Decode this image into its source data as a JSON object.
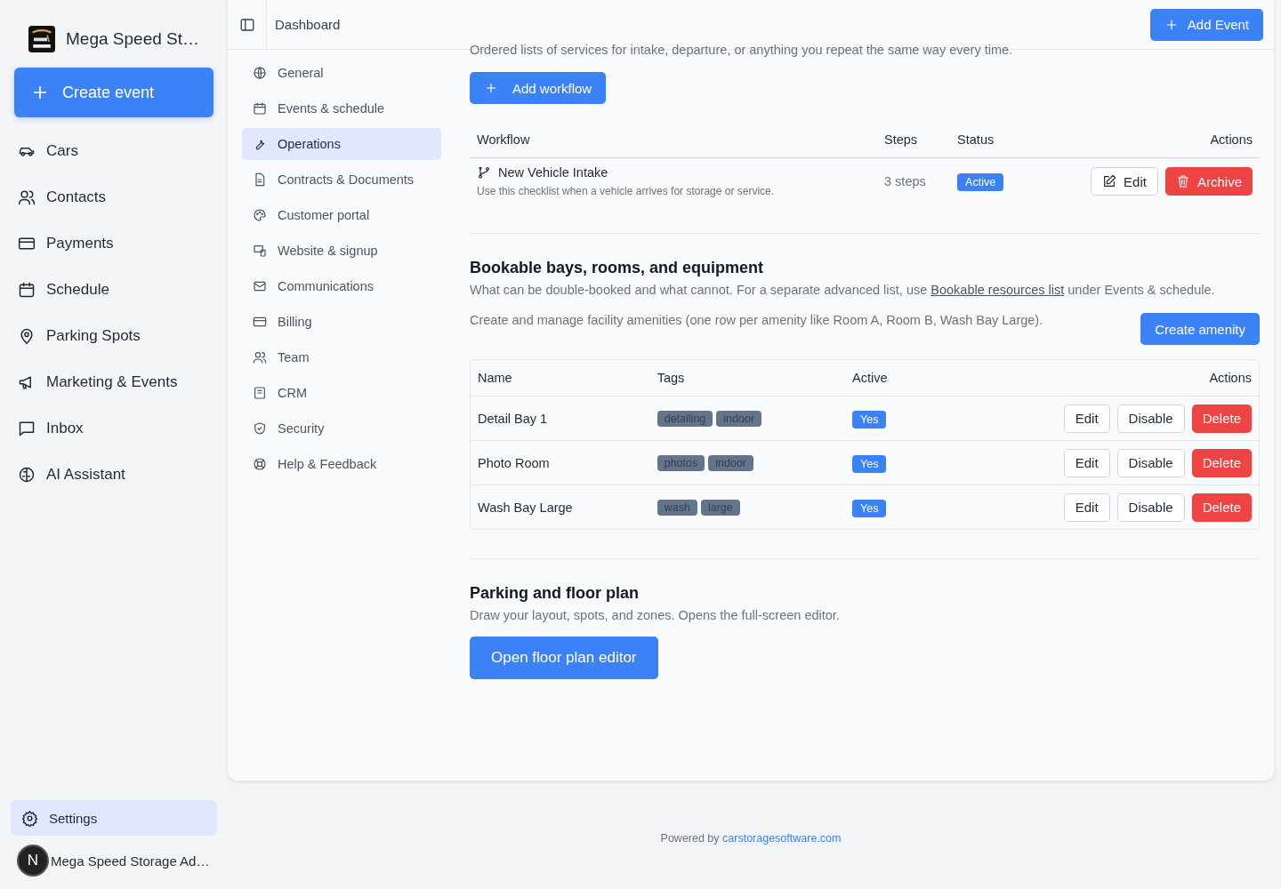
{
  "brand": {
    "name": "Mega Speed St…"
  },
  "create_button": "Create event",
  "sidebar": {
    "items": [
      {
        "label": "Cars"
      },
      {
        "label": "Contacts"
      },
      {
        "label": "Payments"
      },
      {
        "label": "Schedule"
      },
      {
        "label": "Parking Spots"
      },
      {
        "label": "Marketing & Events"
      },
      {
        "label": "Inbox"
      },
      {
        "label": "AI Assistant"
      }
    ],
    "settings": {
      "label": "Settings",
      "selected": true
    },
    "user": {
      "initial": "N",
      "name": "Mega Speed Storage Ad…"
    }
  },
  "header": {
    "breadcrumb": "Dashboard",
    "add_button": "Add Event"
  },
  "settings_nav": [
    {
      "label": "General",
      "selected": false
    },
    {
      "label": "Events & schedule",
      "selected": false
    },
    {
      "label": "Operations",
      "selected": true
    },
    {
      "label": "Contracts & Documents",
      "selected": false
    },
    {
      "label": "Customer portal",
      "selected": false
    },
    {
      "label": "Website & signup",
      "selected": false
    },
    {
      "label": "Communications",
      "selected": false
    },
    {
      "label": "Billing",
      "selected": false
    },
    {
      "label": "Team",
      "selected": false
    },
    {
      "label": "CRM",
      "selected": false
    },
    {
      "label": "Security",
      "selected": false
    },
    {
      "label": "Help & Feedback",
      "selected": false
    }
  ],
  "workflows": {
    "description": "Ordered lists of services for intake, departure, or anything you repeat the same way every time.",
    "add_button": "Add workflow",
    "columns": [
      "Workflow",
      "Steps",
      "Status",
      "Actions"
    ],
    "rows": [
      {
        "name": "New Vehicle Intake",
        "description": "Use this checklist when a vehicle arrives for storage or service.",
        "steps": "3 steps",
        "status": "Active",
        "actions": [
          "Edit",
          "Archive"
        ]
      }
    ]
  },
  "amenities": {
    "title": "Bookable bays, rooms, and equipment",
    "description_before": "What can be double-booked and what cannot. For a separate advanced list, use ",
    "description_link": "Bookable resources list",
    "description_after": " under Events & schedule.",
    "note": "Create and manage facility amenities (one row per amenity like Room A, Room B, Wash Bay Large).",
    "create_button": "Create amenity",
    "columns": [
      "Name",
      "Tags",
      "Active",
      "Actions"
    ],
    "rows": [
      {
        "name": "Detail Bay 1",
        "tags": [
          "detailing",
          "indoor"
        ],
        "active": "Yes",
        "actions": [
          "Edit",
          "Disable",
          "Delete"
        ]
      },
      {
        "name": "Photo Room",
        "tags": [
          "photos",
          "indoor"
        ],
        "active": "Yes",
        "actions": [
          "Edit",
          "Disable",
          "Delete"
        ]
      },
      {
        "name": "Wash Bay Large",
        "tags": [
          "wash",
          "large"
        ],
        "active": "Yes",
        "actions": [
          "Edit",
          "Disable",
          "Delete"
        ]
      }
    ]
  },
  "floor_plan": {
    "title": "Parking and floor plan",
    "description": "Draw your layout, spots, and zones. Opens the full-screen editor.",
    "button": "Open floor plan editor"
  },
  "footer": {
    "prefix": "Powered by",
    "link": "carstoragesoftware.com"
  }
}
